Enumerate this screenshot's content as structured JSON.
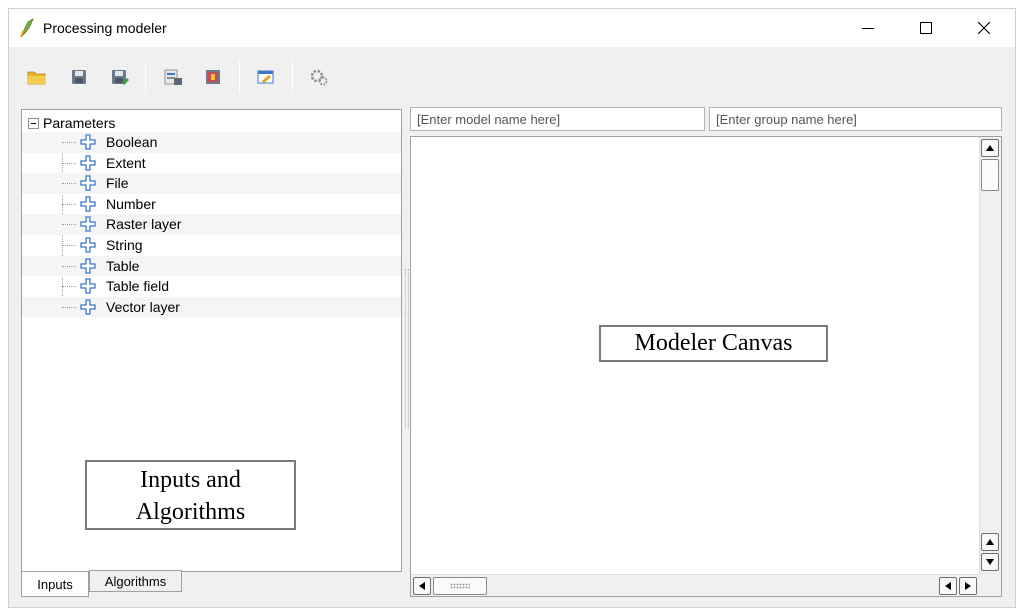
{
  "window": {
    "title": "Processing modeler",
    "app_icon": "qgis-processing-icon",
    "controls": [
      "minimize-icon",
      "maximize-icon",
      "close-icon"
    ]
  },
  "toolbar": {
    "buttons": [
      "open-folder-icon",
      "save-icon",
      "save-as-icon",
      "export-image-icon",
      "export-python-icon",
      "edit-help-icon",
      "run-model-icon"
    ]
  },
  "tree": {
    "root_label": "Parameters",
    "items": [
      "Boolean",
      "Extent",
      "File",
      "Number",
      "Raster layer",
      "String",
      "Table",
      "Table field",
      "Vector layer"
    ]
  },
  "annotations": {
    "inputs_line1": "Inputs and",
    "inputs_line2": "Algorithms",
    "canvas": "Modeler Canvas"
  },
  "tabs": {
    "inputs": "Inputs",
    "algorithms": "Algorithms"
  },
  "fields": {
    "model_name_placeholder": "[Enter model name here]",
    "group_name_placeholder": "[Enter group name here]"
  },
  "colors": {
    "plus_icon": "#3c78c8",
    "folder": "#e8b430"
  }
}
